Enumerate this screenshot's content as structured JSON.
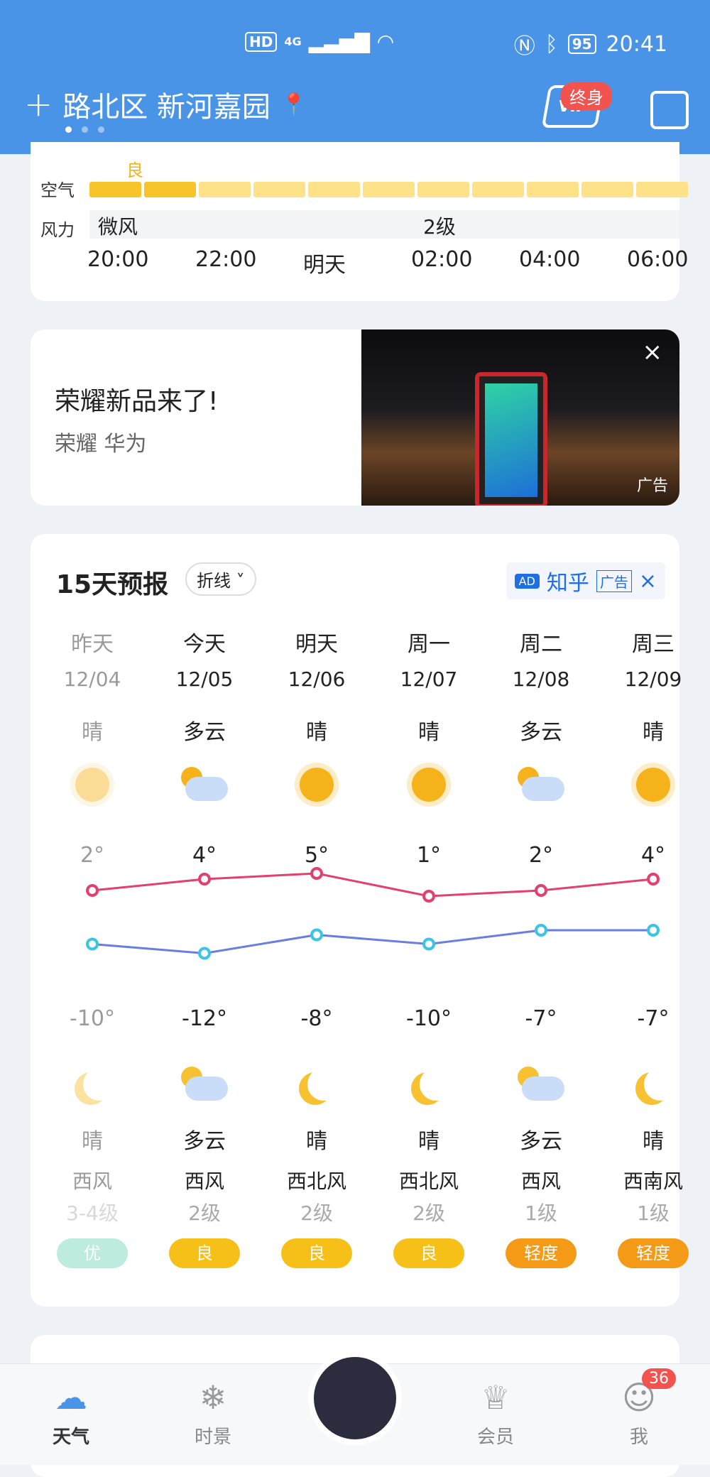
{
  "status": {
    "net1": "HD",
    "net2": "4G",
    "battery": "95",
    "time": "20:41"
  },
  "header": {
    "location": "路北区 新河嘉园",
    "vip_badge": "终身"
  },
  "air": {
    "air_label": "空气",
    "quality_label": "良",
    "wind_label": "风力",
    "wind_a": "微风",
    "wind_b": "2级",
    "times": [
      "20:00",
      "22:00",
      "明天",
      "02:00",
      "04:00",
      "06:00"
    ]
  },
  "ad": {
    "title": "荣耀新品来了!",
    "subtitle": "荣耀 华为",
    "close": "×",
    "tag": "广告"
  },
  "forecast": {
    "title": "15天预报",
    "mode": "折线",
    "zhihu_ad": "AD",
    "zhihu_brand": "知乎",
    "zhihu_tag": "广告",
    "close": "×",
    "days": [
      {
        "day": "昨天",
        "date": "12/04",
        "weather_day": "晴",
        "icon_day": "sun-icon",
        "high": "2°",
        "low": "-10°",
        "weather_night": "晴",
        "icon_night": "moon-icon",
        "wind_dir": "西风",
        "wind_level": "3-4级",
        "aqi": "优",
        "aqi_color": "#6fd3b5"
      },
      {
        "day": "今天",
        "date": "12/05",
        "weather_day": "多云",
        "icon_day": "partly-cloudy-icon",
        "high": "4°",
        "low": "-12°",
        "weather_night": "多云",
        "icon_night": "cloudy-night-icon",
        "wind_dir": "西风",
        "wind_level": "2级",
        "aqi": "良",
        "aqi_color": "#f7c018"
      },
      {
        "day": "明天",
        "date": "12/06",
        "weather_day": "晴",
        "icon_day": "sun-icon",
        "high": "5°",
        "low": "-8°",
        "weather_night": "晴",
        "icon_night": "moon-icon",
        "wind_dir": "西北风",
        "wind_level": "2级",
        "aqi": "良",
        "aqi_color": "#f7c018"
      },
      {
        "day": "周一",
        "date": "12/07",
        "weather_day": "晴",
        "icon_day": "sun-icon",
        "high": "1°",
        "low": "-10°",
        "weather_night": "晴",
        "icon_night": "moon-icon",
        "wind_dir": "西北风",
        "wind_level": "2级",
        "aqi": "良",
        "aqi_color": "#f7c018"
      },
      {
        "day": "周二",
        "date": "12/08",
        "weather_day": "多云",
        "icon_day": "partly-cloudy-icon",
        "high": "2°",
        "low": "-7°",
        "weather_night": "多云",
        "icon_night": "cloudy-night-icon",
        "wind_dir": "西风",
        "wind_level": "1级",
        "aqi": "轻度",
        "aqi_color": "#f59a17"
      },
      {
        "day": "周三",
        "date": "12/09",
        "weather_day": "晴",
        "icon_day": "sun-icon",
        "high": "4°",
        "low": "-7°",
        "weather_night": "晴",
        "icon_night": "moon-icon",
        "wind_dir": "西南风",
        "wind_level": "1级",
        "aqi": "轻度",
        "aqi_color": "#f59a17"
      }
    ]
  },
  "tabs": [
    {
      "label": "天气",
      "icon": "cloud-icon"
    },
    {
      "label": "时景",
      "icon": "snowflake-icon"
    },
    {
      "label": "",
      "icon": "center-logo-icon"
    },
    {
      "label": "会员",
      "icon": "crown-icon"
    },
    {
      "label": "我",
      "icon": "user-icon",
      "badge": "36"
    }
  ]
}
